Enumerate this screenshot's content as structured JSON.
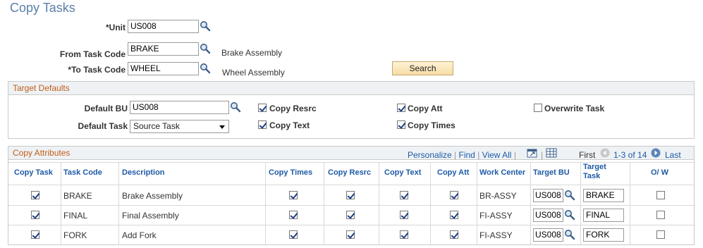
{
  "page": {
    "title": "Copy Tasks"
  },
  "form": {
    "unit": {
      "label": "*Unit",
      "value": "US008"
    },
    "from_task": {
      "label": "From Task Code",
      "value": "BRAKE",
      "description": "Brake Assembly"
    },
    "to_task": {
      "label": "*To Task Code",
      "value": "WHEEL",
      "description": "Wheel Assembly"
    },
    "search_button": "Search"
  },
  "target_defaults": {
    "header": "Target Defaults",
    "default_bu": {
      "label": "Default BU",
      "value": "US008"
    },
    "default_task": {
      "label": "Default Task",
      "value": "Source Task"
    },
    "copy_resrc": {
      "label": "Copy Resrc",
      "checked": true
    },
    "copy_att": {
      "label": "Copy Att",
      "checked": true
    },
    "overwrite_task": {
      "label": "Overwrite Task",
      "checked": false
    },
    "copy_text": {
      "label": "Copy Text",
      "checked": true
    },
    "copy_times": {
      "label": "Copy Times",
      "checked": true
    }
  },
  "copy_attributes": {
    "header": "Copy Attributes",
    "toolbar": {
      "personalize": "Personalize",
      "find": "Find",
      "view_all": "View All",
      "sep": "|",
      "first": "First",
      "range": "1-3 of 14",
      "last": "Last"
    },
    "columns": {
      "copy_task": "Copy Task",
      "task_code": "Task Code",
      "description": "Description",
      "copy_times": "Copy Times",
      "copy_resrc": "Copy Resrc",
      "copy_text": "Copy Text",
      "copy_att": "Copy Att",
      "work_center": "Work Center",
      "target_bu": "Target BU",
      "target_task_1": "Target",
      "target_task_2": "Task",
      "ow": "O/ W"
    },
    "rows": [
      {
        "task_code": "BRAKE",
        "description": "Brake Assembly",
        "work_center": "BR-ASSY",
        "target_bu": "US008",
        "target_task": "BRAKE"
      },
      {
        "task_code": "FINAL",
        "description": "Final Assembly",
        "work_center": "FI-ASSY",
        "target_bu": "US008",
        "target_task": "FINAL"
      },
      {
        "task_code": "FORK",
        "description": "Add Fork",
        "work_center": "FI-ASSY",
        "target_bu": "US008",
        "target_task": "FORK"
      }
    ]
  },
  "icons": {
    "lookup": "magnifier-icon",
    "zoom": "zoom-icon",
    "download": "download-grid-icon"
  }
}
